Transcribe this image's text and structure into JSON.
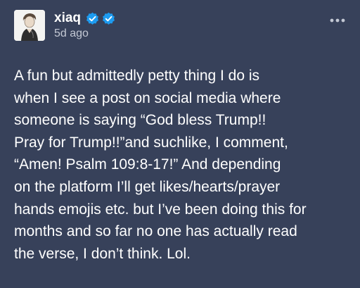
{
  "post": {
    "author": {
      "username": "xiaq",
      "badges": [
        {
          "icon": "verified-checkmark-icon",
          "color": "#1d9bf0"
        },
        {
          "icon": "verified-checkmark-icon",
          "color": "#1d9bf0"
        }
      ]
    },
    "timestamp": "5d ago",
    "menu_icon": "more-options-icon",
    "body_lines": [
      "A fun but admittedly petty thing I do is",
      "when I see a post on social media where",
      "someone is saying “God bless Trump!!",
      "Pray for Trump!!”and suchlike, I comment,",
      "“Amen! Psalm 109:8-17!” And depending",
      "on the platform I’ll get likes/hearts/prayer",
      "hands emojis etc. but I’ve been doing this for",
      "months and so far no one has actually read",
      "the verse, I don’t think. Lol."
    ]
  },
  "colors": {
    "background": "#37415a",
    "text": "#ffffff",
    "muted_text": "#c3c8d4",
    "badge": "#1d9bf0"
  }
}
